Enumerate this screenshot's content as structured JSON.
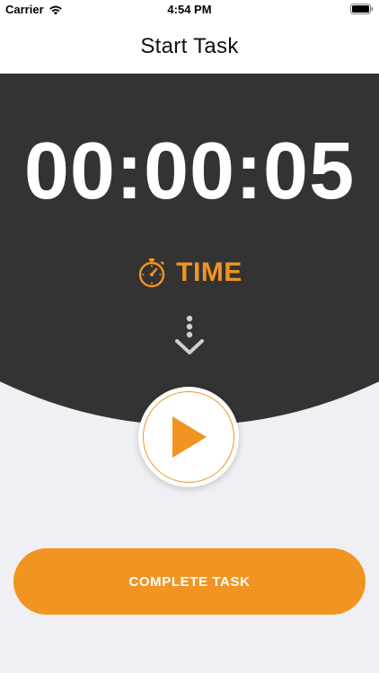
{
  "status_bar": {
    "carrier": "Carrier",
    "time": "4:54 PM"
  },
  "nav": {
    "title": "Start Task"
  },
  "timer": {
    "display": "00:00:05",
    "label": "TIME"
  },
  "actions": {
    "play_icon": "play-icon",
    "complete_label": "COMPLETE TASK"
  },
  "colors": {
    "accent": "#f29421",
    "dark_panel": "#333333",
    "background": "#efeff4"
  }
}
